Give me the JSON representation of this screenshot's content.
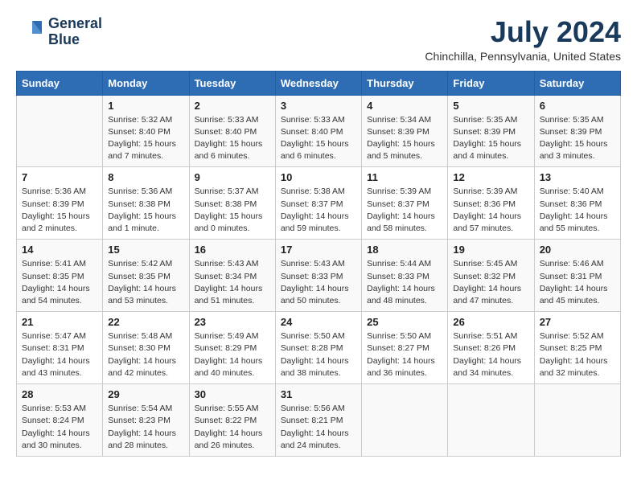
{
  "logo": {
    "line1": "General",
    "line2": "Blue"
  },
  "title": "July 2024",
  "location": "Chinchilla, Pennsylvania, United States",
  "days_of_week": [
    "Sunday",
    "Monday",
    "Tuesday",
    "Wednesday",
    "Thursday",
    "Friday",
    "Saturday"
  ],
  "weeks": [
    [
      {
        "num": "",
        "info": ""
      },
      {
        "num": "1",
        "info": "Sunrise: 5:32 AM\nSunset: 8:40 PM\nDaylight: 15 hours\nand 7 minutes."
      },
      {
        "num": "2",
        "info": "Sunrise: 5:33 AM\nSunset: 8:40 PM\nDaylight: 15 hours\nand 6 minutes."
      },
      {
        "num": "3",
        "info": "Sunrise: 5:33 AM\nSunset: 8:40 PM\nDaylight: 15 hours\nand 6 minutes."
      },
      {
        "num": "4",
        "info": "Sunrise: 5:34 AM\nSunset: 8:39 PM\nDaylight: 15 hours\nand 5 minutes."
      },
      {
        "num": "5",
        "info": "Sunrise: 5:35 AM\nSunset: 8:39 PM\nDaylight: 15 hours\nand 4 minutes."
      },
      {
        "num": "6",
        "info": "Sunrise: 5:35 AM\nSunset: 8:39 PM\nDaylight: 15 hours\nand 3 minutes."
      }
    ],
    [
      {
        "num": "7",
        "info": "Sunrise: 5:36 AM\nSunset: 8:39 PM\nDaylight: 15 hours\nand 2 minutes."
      },
      {
        "num": "8",
        "info": "Sunrise: 5:36 AM\nSunset: 8:38 PM\nDaylight: 15 hours\nand 1 minute."
      },
      {
        "num": "9",
        "info": "Sunrise: 5:37 AM\nSunset: 8:38 PM\nDaylight: 15 hours\nand 0 minutes."
      },
      {
        "num": "10",
        "info": "Sunrise: 5:38 AM\nSunset: 8:37 PM\nDaylight: 14 hours\nand 59 minutes."
      },
      {
        "num": "11",
        "info": "Sunrise: 5:39 AM\nSunset: 8:37 PM\nDaylight: 14 hours\nand 58 minutes."
      },
      {
        "num": "12",
        "info": "Sunrise: 5:39 AM\nSunset: 8:36 PM\nDaylight: 14 hours\nand 57 minutes."
      },
      {
        "num": "13",
        "info": "Sunrise: 5:40 AM\nSunset: 8:36 PM\nDaylight: 14 hours\nand 55 minutes."
      }
    ],
    [
      {
        "num": "14",
        "info": "Sunrise: 5:41 AM\nSunset: 8:35 PM\nDaylight: 14 hours\nand 54 minutes."
      },
      {
        "num": "15",
        "info": "Sunrise: 5:42 AM\nSunset: 8:35 PM\nDaylight: 14 hours\nand 53 minutes."
      },
      {
        "num": "16",
        "info": "Sunrise: 5:43 AM\nSunset: 8:34 PM\nDaylight: 14 hours\nand 51 minutes."
      },
      {
        "num": "17",
        "info": "Sunrise: 5:43 AM\nSunset: 8:33 PM\nDaylight: 14 hours\nand 50 minutes."
      },
      {
        "num": "18",
        "info": "Sunrise: 5:44 AM\nSunset: 8:33 PM\nDaylight: 14 hours\nand 48 minutes."
      },
      {
        "num": "19",
        "info": "Sunrise: 5:45 AM\nSunset: 8:32 PM\nDaylight: 14 hours\nand 47 minutes."
      },
      {
        "num": "20",
        "info": "Sunrise: 5:46 AM\nSunset: 8:31 PM\nDaylight: 14 hours\nand 45 minutes."
      }
    ],
    [
      {
        "num": "21",
        "info": "Sunrise: 5:47 AM\nSunset: 8:31 PM\nDaylight: 14 hours\nand 43 minutes."
      },
      {
        "num": "22",
        "info": "Sunrise: 5:48 AM\nSunset: 8:30 PM\nDaylight: 14 hours\nand 42 minutes."
      },
      {
        "num": "23",
        "info": "Sunrise: 5:49 AM\nSunset: 8:29 PM\nDaylight: 14 hours\nand 40 minutes."
      },
      {
        "num": "24",
        "info": "Sunrise: 5:50 AM\nSunset: 8:28 PM\nDaylight: 14 hours\nand 38 minutes."
      },
      {
        "num": "25",
        "info": "Sunrise: 5:50 AM\nSunset: 8:27 PM\nDaylight: 14 hours\nand 36 minutes."
      },
      {
        "num": "26",
        "info": "Sunrise: 5:51 AM\nSunset: 8:26 PM\nDaylight: 14 hours\nand 34 minutes."
      },
      {
        "num": "27",
        "info": "Sunrise: 5:52 AM\nSunset: 8:25 PM\nDaylight: 14 hours\nand 32 minutes."
      }
    ],
    [
      {
        "num": "28",
        "info": "Sunrise: 5:53 AM\nSunset: 8:24 PM\nDaylight: 14 hours\nand 30 minutes."
      },
      {
        "num": "29",
        "info": "Sunrise: 5:54 AM\nSunset: 8:23 PM\nDaylight: 14 hours\nand 28 minutes."
      },
      {
        "num": "30",
        "info": "Sunrise: 5:55 AM\nSunset: 8:22 PM\nDaylight: 14 hours\nand 26 minutes."
      },
      {
        "num": "31",
        "info": "Sunrise: 5:56 AM\nSunset: 8:21 PM\nDaylight: 14 hours\nand 24 minutes."
      },
      {
        "num": "",
        "info": ""
      },
      {
        "num": "",
        "info": ""
      },
      {
        "num": "",
        "info": ""
      }
    ]
  ]
}
